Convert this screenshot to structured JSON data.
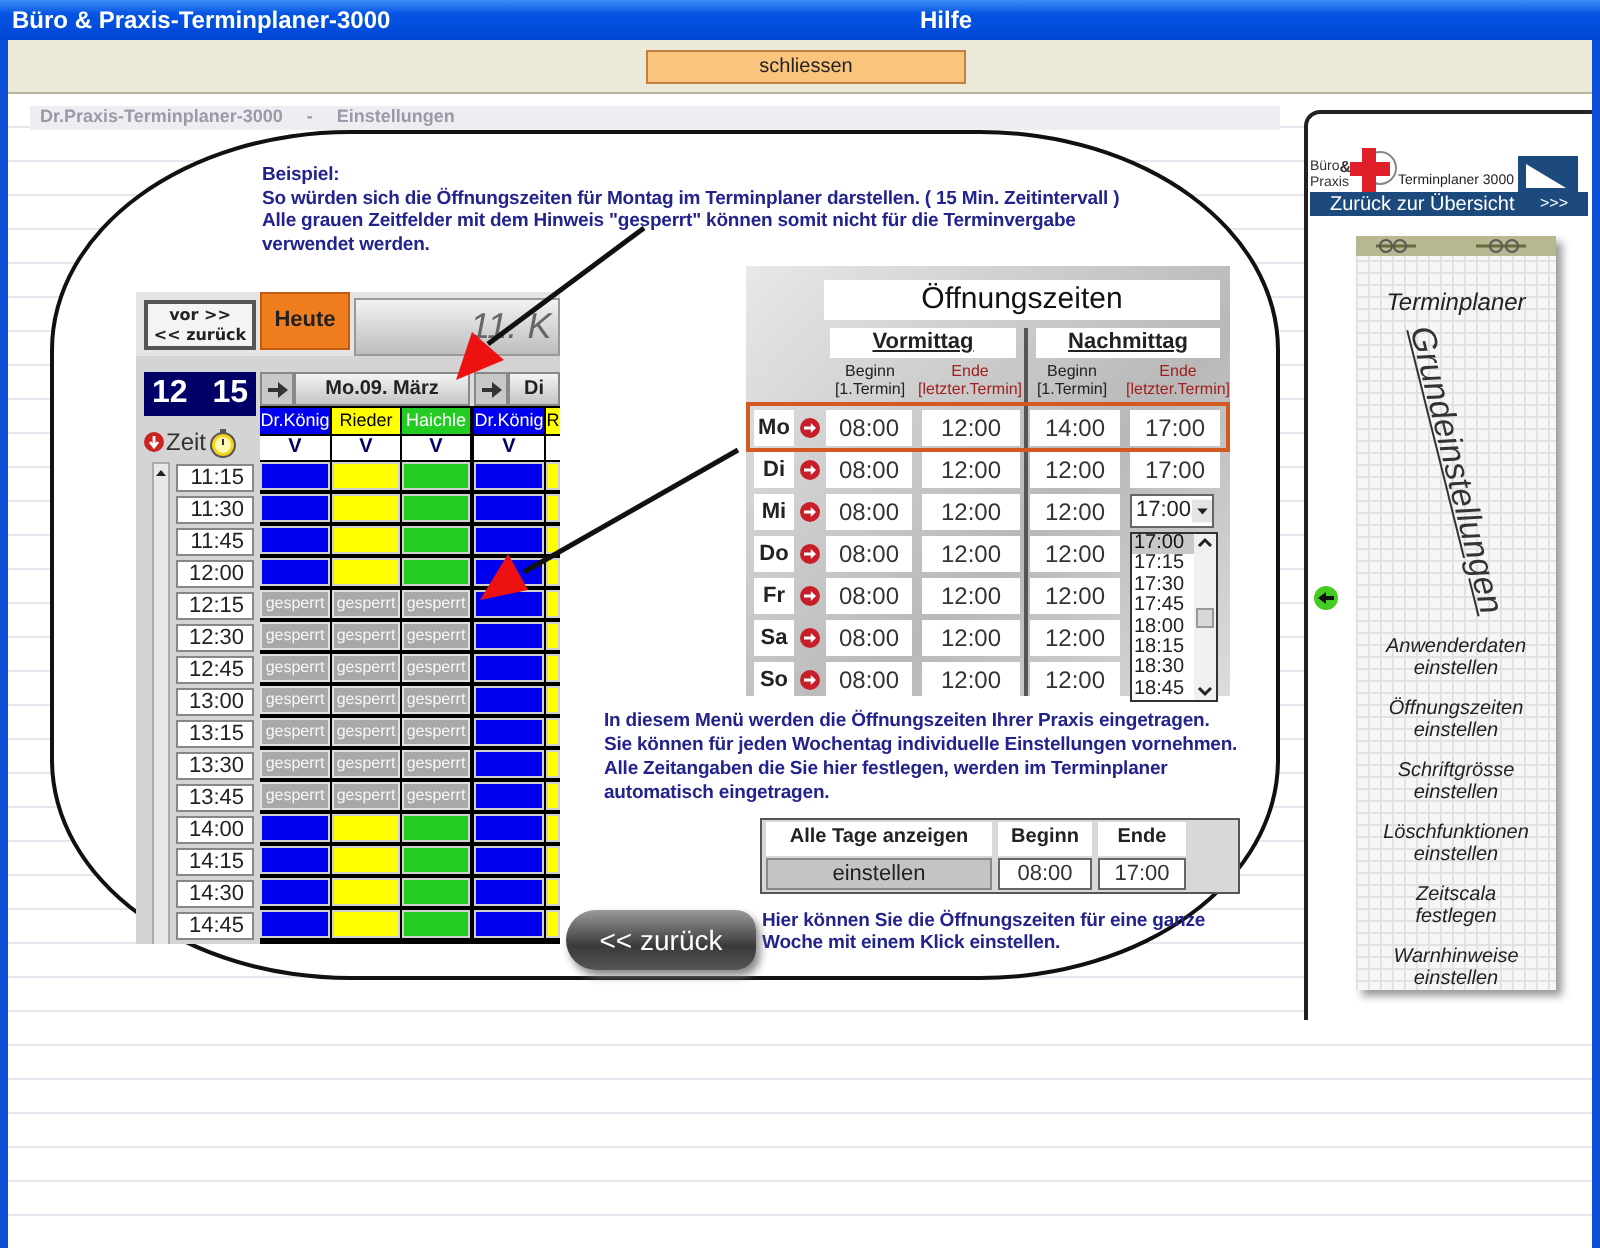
{
  "window": {
    "title": "Büro & Praxis-Terminplaner-3000",
    "section": "Hilfe"
  },
  "toolbar": {
    "close_button": "schliessen"
  },
  "background_header": {
    "app": "Dr.Praxis-Terminplaner-3000",
    "separator": "-",
    "page": "Einstellungen"
  },
  "intro": {
    "heading": "Beispiel:",
    "lines": [
      "So würden sich die Öffnungszeiten für Montag im Terminplaner darstellen. ( 15 Min. Zeitintervall )",
      "Alle grauen Zeitfelder mit dem Hinweis \"gesperrt\" können somit nicht für die Terminvergabe verwendet werden."
    ]
  },
  "planner": {
    "nav_buttons": [
      "vor >>",
      "<< zurück"
    ],
    "today_button": "Heute",
    "date_title": "11. K",
    "clock": "12 15",
    "time_label": "Zeit",
    "days": [
      {
        "label": "Mo.09. März",
        "columns": [
          {
            "name": "Dr.König",
            "color": "#0000ee",
            "flag": "V"
          },
          {
            "name": "Rieder",
            "color": "#ffff00",
            "flag": "V"
          },
          {
            "name": "Haichle",
            "color": "#22cc22",
            "flag": "V"
          }
        ]
      },
      {
        "label": "Di",
        "columns": [
          {
            "name": "Dr.König",
            "color": "#0000ee",
            "flag": "V"
          },
          {
            "name": "R",
            "color": "#ffff00"
          }
        ]
      }
    ],
    "rows": [
      {
        "time": "11:15",
        "blocked": false
      },
      {
        "time": "11:30",
        "blocked": false
      },
      {
        "time": "11:45",
        "blocked": false
      },
      {
        "time": "12:00",
        "blocked": false
      },
      {
        "time": "12:15",
        "blocked": true,
        "labels": [
          "gesperrt",
          "gesperrt",
          "gesperrt"
        ]
      },
      {
        "time": "12:30",
        "blocked": true,
        "labels": [
          "gesperrt",
          "gesperrt",
          "gesperrt"
        ]
      },
      {
        "time": "12:45",
        "blocked": true,
        "labels": [
          "gesperrt",
          "gesperrt",
          "gesperrt"
        ]
      },
      {
        "time": "13:00",
        "blocked": true,
        "labels": [
          "gesperrt",
          "gesperrt",
          "gesperrt"
        ]
      },
      {
        "time": "13:15",
        "blocked": true,
        "labels": [
          "gesperrt",
          "gesperrt",
          "gesperrt"
        ]
      },
      {
        "time": "13:30",
        "blocked": true,
        "labels": [
          "gesperrt",
          "gesperrt",
          "gesperrt"
        ]
      },
      {
        "time": "13:45",
        "blocked": true,
        "labels": [
          "gesperrt",
          "gesperrt",
          "gesperrt"
        ]
      },
      {
        "time": "14:00",
        "blocked": false
      },
      {
        "time": "14:15",
        "blocked": false
      },
      {
        "time": "14:30",
        "blocked": false
      },
      {
        "time": "14:45",
        "blocked": false
      }
    ]
  },
  "opening_hours": {
    "title": "Öffnungszeiten",
    "periods": [
      {
        "label": "Vormittag",
        "columns": [
          {
            "kind": "begin",
            "top": "Beginn",
            "bottom": "[1.Termin]"
          },
          {
            "kind": "end",
            "top": "Ende",
            "bottom": "[letzter.Termin]"
          }
        ]
      },
      {
        "label": "Nachmittag",
        "columns": [
          {
            "kind": "begin",
            "top": "Beginn",
            "bottom": "[1.Termin]"
          },
          {
            "kind": "end",
            "top": "Ende",
            "bottom": "[letzter.Termin]"
          }
        ]
      }
    ],
    "rows": [
      {
        "day": "Mo",
        "selected": true,
        "times": [
          "08:00",
          "12:00",
          "14:00",
          "17:00"
        ]
      },
      {
        "day": "Di",
        "selected": false,
        "times": [
          "08:00",
          "12:00",
          "12:00",
          "17:00"
        ]
      },
      {
        "day": "Mi",
        "selected": false,
        "times": [
          "08:00",
          "12:00",
          "12:00"
        ],
        "dropdown": {
          "value": "17:00",
          "options": [
            {
              "label": "17:00",
              "selected": true
            },
            {
              "label": "17:15",
              "selected": false
            },
            {
              "label": "17:30",
              "selected": false
            },
            {
              "label": "17:45",
              "selected": false
            },
            {
              "label": "18:00",
              "selected": false
            },
            {
              "label": "18:15",
              "selected": false
            },
            {
              "label": "18:30",
              "selected": false
            },
            {
              "label": "18:45",
              "selected": false
            }
          ]
        }
      },
      {
        "day": "Do",
        "selected": false,
        "times": [
          "08:00",
          "12:00",
          "12:00"
        ]
      },
      {
        "day": "Fr",
        "selected": false,
        "times": [
          "08:00",
          "12:00",
          "12:00"
        ]
      },
      {
        "day": "Sa",
        "selected": false,
        "times": [
          "08:00",
          "12:00",
          "12:00"
        ]
      },
      {
        "day": "So",
        "selected": false,
        "times": [
          "08:00",
          "12:00",
          "12:00"
        ]
      }
    ]
  },
  "explanation": [
    "In diesem Menü werden die Öffnungszeiten Ihrer Praxis eingetragen.",
    "Sie können für jeden Wochentag individuelle Einstellungen vornehmen.",
    "Alle Zeitangaben die Sie hier festlegen, werden im Terminplaner automatisch eingetragen."
  ],
  "week_setup": {
    "heading": "Alle Tage anzeigen",
    "button": "einstellen",
    "begin_label": "Beginn",
    "begin": "08:00",
    "end_label": "Ende",
    "end": "17:00"
  },
  "hint": "Hier können Sie die Öffnungszeiten für eine ganze Woche mit einem Klick einstellen.",
  "back_button": "<< zurück",
  "sidebar": {
    "logo": {
      "line1": "Büro",
      "amp": "&",
      "line2": "Praxis",
      "name": "Terminplaner 3000"
    },
    "back_link": {
      "label": "Zurück zur Übersicht",
      "arrows": ">>>"
    },
    "card": {
      "title": "Terminplaner",
      "heading": "Grundeinstellungen",
      "items": [
        {
          "lines": [
            "Anwenderdaten",
            "einstellen"
          ]
        },
        {
          "lines": [
            "Öffnungszeiten",
            "einstellen"
          ]
        },
        {
          "lines": [
            "Schriftgrösse",
            "einstellen"
          ]
        },
        {
          "lines": [
            "Löschfunktionen",
            "einstellen"
          ]
        },
        {
          "lines": [
            "Zeitscala",
            "festlegen"
          ]
        },
        {
          "lines": [
            "Warnhinweise",
            "einstellen"
          ]
        }
      ]
    }
  }
}
